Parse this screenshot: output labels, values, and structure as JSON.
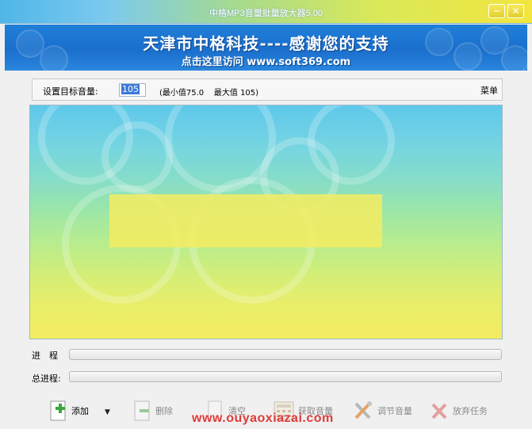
{
  "window": {
    "title": "中格MP3音量批量放大器5.00",
    "minimize_glyph": "─",
    "close_glyph": "✕"
  },
  "banner": {
    "headline": "天津市中格科技----感谢您的支持",
    "link_text": "点击这里访问 www.soft369.com"
  },
  "settings": {
    "target_label": "设置目标音量:",
    "volume_value": "105",
    "min_text": "(最小值75.0",
    "max_text": "最大值 105)",
    "menu_label": "菜单"
  },
  "progress": {
    "current_label": "进　程",
    "total_label": "总进程:",
    "current_value": 0,
    "total_value": 0
  },
  "toolbar": {
    "add_label": "添加",
    "delete_label": "删除",
    "clear_label": "清空",
    "get_volume_label": "获取音量",
    "adjust_volume_label": "调节音量",
    "abort_label": "放弃任务",
    "dropdown_glyph": "▼"
  },
  "watermark": {
    "text": "www.ouyaoxiazai.com"
  },
  "colors": {
    "accent": "#1a6fcc",
    "watermark": "#e03a3a"
  }
}
